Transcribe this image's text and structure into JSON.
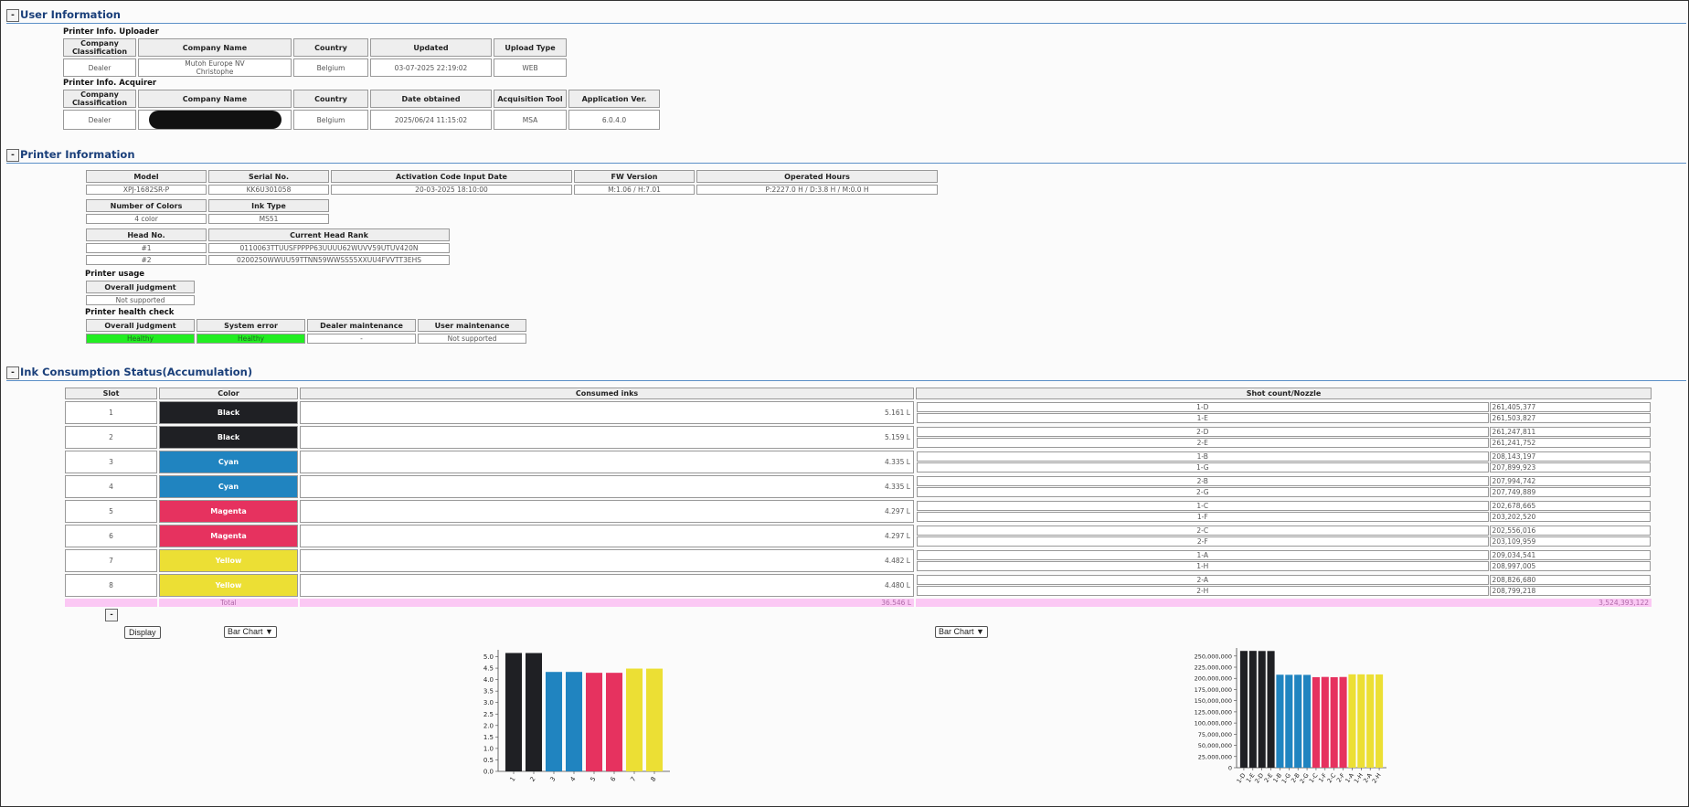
{
  "sections": {
    "user_info": {
      "title": "User Information",
      "toggle": "-"
    },
    "printer_info": {
      "title": "Printer Information",
      "toggle": "-"
    },
    "ink": {
      "title": "Ink Consumption Status(Accumulation)",
      "toggle": "-"
    }
  },
  "uploader": {
    "title": "Printer Info. Uploader",
    "headers": [
      "Company Classification",
      "Company Name",
      "Country",
      "Updated",
      "Upload Type"
    ],
    "row": {
      "classification": "Dealer",
      "company_line1": "Mutoh Europe NV",
      "company_line2": "Christophe",
      "country": "Belgium",
      "updated": "03-07-2025 22:19:02",
      "upload_type": "WEB"
    }
  },
  "acquirer": {
    "title": "Printer Info. Acquirer",
    "headers": [
      "Company Classification",
      "Company Name",
      "Country",
      "Date obtained",
      "Acquisition Tool",
      "Application Ver."
    ],
    "row": {
      "classification": "Dealer",
      "country": "Belgium",
      "date": "2025/06/24 11:15:02",
      "tool": "MSA",
      "version": "6.0.4.0"
    }
  },
  "printer": {
    "headers1": [
      "Model",
      "Serial No.",
      "Activation Code Input Date",
      "FW Version",
      "Operated Hours"
    ],
    "row1": {
      "model": "XPJ-1682SR-P",
      "serial": "KK6U301058",
      "activation": "20-03-2025 18:10:00",
      "fw": "M:1.06 / H:7.01",
      "hours": "P:2227.0 H / D:3.8 H / M:0.0 H"
    },
    "headers2": [
      "Number of Colors",
      "Ink Type"
    ],
    "row2": {
      "colors": "4 color",
      "ink_type": "MS51"
    },
    "headers3": [
      "Head No.",
      "Current Head Rank"
    ],
    "heads": [
      {
        "no": "#1",
        "rank": "0110063TTUUSFPPPP63UUUU62WUVV59UTUV420N"
      },
      {
        "no": "#2",
        "rank": "0200250WWUU59TTNN59WWSS55XXUU4FVVTT3EHS"
      }
    ],
    "usage": {
      "title": "Printer usage",
      "header": "Overall judgment",
      "value": "Not supported"
    },
    "health": {
      "title": "Printer health check",
      "headers": [
        "Overall judgment",
        "System error",
        "Dealer maintenance",
        "User maintenance"
      ],
      "values": [
        "Healthy",
        "Healthy",
        "-",
        "Not supported"
      ]
    }
  },
  "ink_table": {
    "headers": [
      "Slot",
      "Color",
      "Consumed inks",
      "Shot count/Nozzle"
    ],
    "rows": [
      {
        "slot": "1",
        "color": "Black",
        "hex": "#1f2024",
        "consumed": "5.161 L",
        "nozzles": [
          [
            "1-D",
            "261,405,377"
          ],
          [
            "1-E",
            "261,503,827"
          ]
        ]
      },
      {
        "slot": "2",
        "color": "Black",
        "hex": "#1f2024",
        "consumed": "5.159 L",
        "nozzles": [
          [
            "2-D",
            "261,247,811"
          ],
          [
            "2-E",
            "261,241,752"
          ]
        ]
      },
      {
        "slot": "3",
        "color": "Cyan",
        "hex": "#2084c0",
        "consumed": "4.335 L",
        "nozzles": [
          [
            "1-B",
            "208,143,197"
          ],
          [
            "1-G",
            "207,899,923"
          ]
        ]
      },
      {
        "slot": "4",
        "color": "Cyan",
        "hex": "#2084c0",
        "consumed": "4.335 L",
        "nozzles": [
          [
            "2-B",
            "207,994,742"
          ],
          [
            "2-G",
            "207,749,889"
          ]
        ]
      },
      {
        "slot": "5",
        "color": "Magenta",
        "hex": "#e6325f",
        "consumed": "4.297 L",
        "nozzles": [
          [
            "1-C",
            "202,678,665"
          ],
          [
            "1-F",
            "203,202,520"
          ]
        ]
      },
      {
        "slot": "6",
        "color": "Magenta",
        "hex": "#e6325f",
        "consumed": "4.297 L",
        "nozzles": [
          [
            "2-C",
            "202,556,016"
          ],
          [
            "2-F",
            "203,109,959"
          ]
        ]
      },
      {
        "slot": "7",
        "color": "Yellow",
        "hex": "#ecdf34",
        "consumed": "4.482 L",
        "nozzles": [
          [
            "1-A",
            "209,034,541"
          ],
          [
            "1-H",
            "208,997,005"
          ]
        ]
      },
      {
        "slot": "8",
        "color": "Yellow",
        "hex": "#ecdf34",
        "consumed": "4.480 L",
        "nozzles": [
          [
            "2-A",
            "208,826,680"
          ],
          [
            "2-H",
            "208,799,218"
          ]
        ]
      }
    ],
    "total": {
      "label": "Total",
      "consumed": "36.546 L",
      "shots": "3,524,393,122"
    }
  },
  "controls": {
    "collapse": "-",
    "display_button": "Display",
    "left_select": "Bar Chart",
    "right_select": "Bar Chart"
  },
  "chart_data": [
    {
      "type": "bar",
      "categories": [
        "1",
        "2",
        "3",
        "4",
        "5",
        "6",
        "7",
        "8"
      ],
      "values": [
        5.161,
        5.159,
        4.335,
        4.335,
        4.297,
        4.297,
        4.482,
        4.48
      ],
      "colors": [
        "#1f2024",
        "#1f2024",
        "#2084c0",
        "#2084c0",
        "#e6325f",
        "#e6325f",
        "#ecdf34",
        "#ecdf34"
      ],
      "yticks": [
        "0.0",
        "0.5",
        "1.0",
        "1.5",
        "2.0",
        "2.5",
        "3.0",
        "3.5",
        "4.0",
        "4.5",
        "5.0"
      ],
      "ylim": [
        0,
        5.3
      ],
      "title": "",
      "xlabel": "",
      "ylabel": ""
    },
    {
      "type": "bar",
      "categories": [
        "1-D",
        "1-E",
        "2-D",
        "2-E",
        "1-B",
        "1-G",
        "2-B",
        "2-G",
        "1-C",
        "1-F",
        "2-C",
        "2-F",
        "1-A",
        "1-H",
        "2-A",
        "2-H"
      ],
      "values": [
        261405377,
        261503827,
        261247811,
        261241752,
        208143197,
        207899923,
        207994742,
        207749889,
        202678665,
        203202520,
        202556016,
        203109959,
        209034541,
        208997005,
        208826680,
        208799218
      ],
      "colors": [
        "#1f2024",
        "#1f2024",
        "#1f2024",
        "#1f2024",
        "#2084c0",
        "#2084c0",
        "#2084c0",
        "#2084c0",
        "#e6325f",
        "#e6325f",
        "#e6325f",
        "#e6325f",
        "#ecdf34",
        "#ecdf34",
        "#ecdf34",
        "#ecdf34"
      ],
      "yticks": [
        "0",
        "25,000,000",
        "50,000,000",
        "75,000,000",
        "100,000,000",
        "125,000,000",
        "150,000,000",
        "175,000,000",
        "200,000,000",
        "225,000,000",
        "250,000,000"
      ],
      "ylim": [
        0,
        268000000
      ],
      "title": "",
      "xlabel": "",
      "ylabel": ""
    }
  ]
}
